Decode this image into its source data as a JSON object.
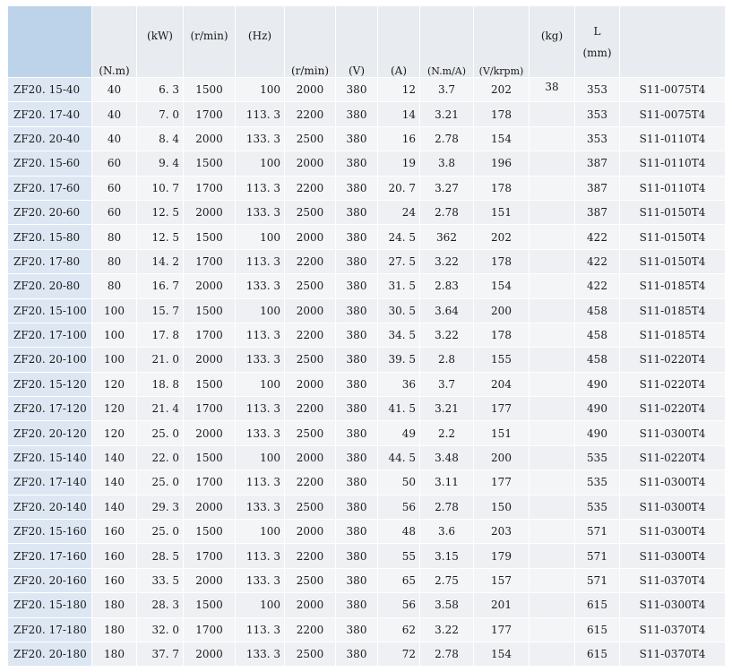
{
  "headers": {
    "model": "",
    "torque": "(N.m)",
    "power": "(kW)",
    "rated_speed": "(r/min)",
    "frequency": "(Hz)",
    "max_speed": "(r/min)",
    "voltage": "(V)",
    "current": "(A)",
    "torque_const": "(N.m/A)",
    "back_emf": "(V/krpm)",
    "weight": "(kg)",
    "length_label": "L",
    "length_unit": "(mm)",
    "inverter": ""
  },
  "rows": [
    [
      "ZF20. 15-40",
      "40",
      "6. 3",
      "1500",
      "100",
      "2000",
      "380",
      "12",
      "3.7",
      "202",
      "38",
      "353",
      "S11-0075T4"
    ],
    [
      "ZF20. 17-40",
      "40",
      "7. 0",
      "1700",
      "113. 3",
      "2200",
      "380",
      "14",
      "3.21",
      "178",
      "",
      "353",
      "S11-0075T4"
    ],
    [
      "ZF20. 20-40",
      "40",
      "8. 4",
      "2000",
      "133. 3",
      "2500",
      "380",
      "16",
      "2.78",
      "154",
      "",
      "353",
      "S11-0110T4"
    ],
    [
      "ZF20. 15-60",
      "60",
      "9. 4",
      "1500",
      "100",
      "2000",
      "380",
      "19",
      "3.8",
      "196",
      "",
      "387",
      "S11-0110T4"
    ],
    [
      "ZF20. 17-60",
      "60",
      "10. 7",
      "1700",
      "113. 3",
      "2200",
      "380",
      "20. 7",
      "3.27",
      "178",
      "",
      "387",
      "S11-0110T4"
    ],
    [
      "ZF20. 20-60",
      "60",
      "12. 5",
      "2000",
      "133. 3",
      "2500",
      "380",
      "24",
      "2.78",
      "151",
      "",
      "387",
      "S11-0150T4"
    ],
    [
      "ZF20. 15-80",
      "80",
      "12. 5",
      "1500",
      "100",
      "2000",
      "380",
      "24. 5",
      "362",
      "202",
      "",
      "422",
      "S11-0150T4"
    ],
    [
      "ZF20. 17-80",
      "80",
      "14. 2",
      "1700",
      "113. 3",
      "2200",
      "380",
      "27. 5",
      "3.22",
      "178",
      "",
      "422",
      "S11-0150T4"
    ],
    [
      "ZF20. 20-80",
      "80",
      "16. 7",
      "2000",
      "133. 3",
      "2500",
      "380",
      "31. 5",
      "2.83",
      "154",
      "",
      "422",
      "S11-0185T4"
    ],
    [
      "ZF20. 15-100",
      "100",
      "15. 7",
      "1500",
      "100",
      "2000",
      "380",
      "30. 5",
      "3.64",
      "200",
      "",
      "458",
      "S11-0185T4"
    ],
    [
      "ZF20. 17-100",
      "100",
      "17. 8",
      "1700",
      "113. 3",
      "2200",
      "380",
      "34. 5",
      "3.22",
      "178",
      "",
      "458",
      "S11-0185T4"
    ],
    [
      "ZF20. 20-100",
      "100",
      "21. 0",
      "2000",
      "133. 3",
      "2500",
      "380",
      "39. 5",
      "2.8",
      "155",
      "",
      "458",
      "S11-0220T4"
    ],
    [
      "ZF20. 15-120",
      "120",
      "18. 8",
      "1500",
      "100",
      "2000",
      "380",
      "36",
      "3.7",
      "204",
      "",
      "490",
      "S11-0220T4"
    ],
    [
      "ZF20. 17-120",
      "120",
      "21. 4",
      "1700",
      "113. 3",
      "2200",
      "380",
      "41. 5",
      "3.21",
      "177",
      "",
      "490",
      "S11-0220T4"
    ],
    [
      "ZF20. 20-120",
      "120",
      "25. 0",
      "2000",
      "133. 3",
      "2500",
      "380",
      "49",
      "2.2",
      "151",
      "",
      "490",
      "S11-0300T4"
    ],
    [
      "ZF20. 15-140",
      "140",
      "22. 0",
      "1500",
      "100",
      "2000",
      "380",
      "44. 5",
      "3.48",
      "200",
      "",
      "535",
      "S11-0220T4"
    ],
    [
      "ZF20. 17-140",
      "140",
      "25. 0",
      "1700",
      "113. 3",
      "2200",
      "380",
      "50",
      "3.11",
      "177",
      "",
      "535",
      "S11-0300T4"
    ],
    [
      "ZF20. 20-140",
      "140",
      "29. 3",
      "2000",
      "133. 3",
      "2500",
      "380",
      "56",
      "2.78",
      "150",
      "",
      "535",
      "S11-0300T4"
    ],
    [
      "ZF20. 15-160",
      "160",
      "25. 0",
      "1500",
      "100",
      "2000",
      "380",
      "48",
      "3.6",
      "203",
      "",
      "571",
      "S11-0300T4"
    ],
    [
      "ZF20. 17-160",
      "160",
      "28. 5",
      "1700",
      "113. 3",
      "2200",
      "380",
      "55",
      "3.15",
      "179",
      "",
      "571",
      "S11-0300T4"
    ],
    [
      "ZF20. 20-160",
      "160",
      "33. 5",
      "2000",
      "133. 3",
      "2500",
      "380",
      "65",
      "2.75",
      "157",
      "",
      "571",
      "S11-0370T4"
    ],
    [
      "ZF20. 15-180",
      "180",
      "28. 3",
      "1500",
      "100",
      "2000",
      "380",
      "56",
      "3.58",
      "201",
      "",
      "615",
      "S11-0300T4"
    ],
    [
      "ZF20. 17-180",
      "180",
      "32. 0",
      "1700",
      "113. 3",
      "2200",
      "380",
      "62",
      "3.22",
      "177",
      "",
      "615",
      "S11-0370T4"
    ],
    [
      "ZF20. 20-180",
      "180",
      "37. 7",
      "2000",
      "133. 3",
      "2500",
      "380",
      "72",
      "2.78",
      "154",
      "",
      "615",
      "S11-0370T4"
    ]
  ]
}
